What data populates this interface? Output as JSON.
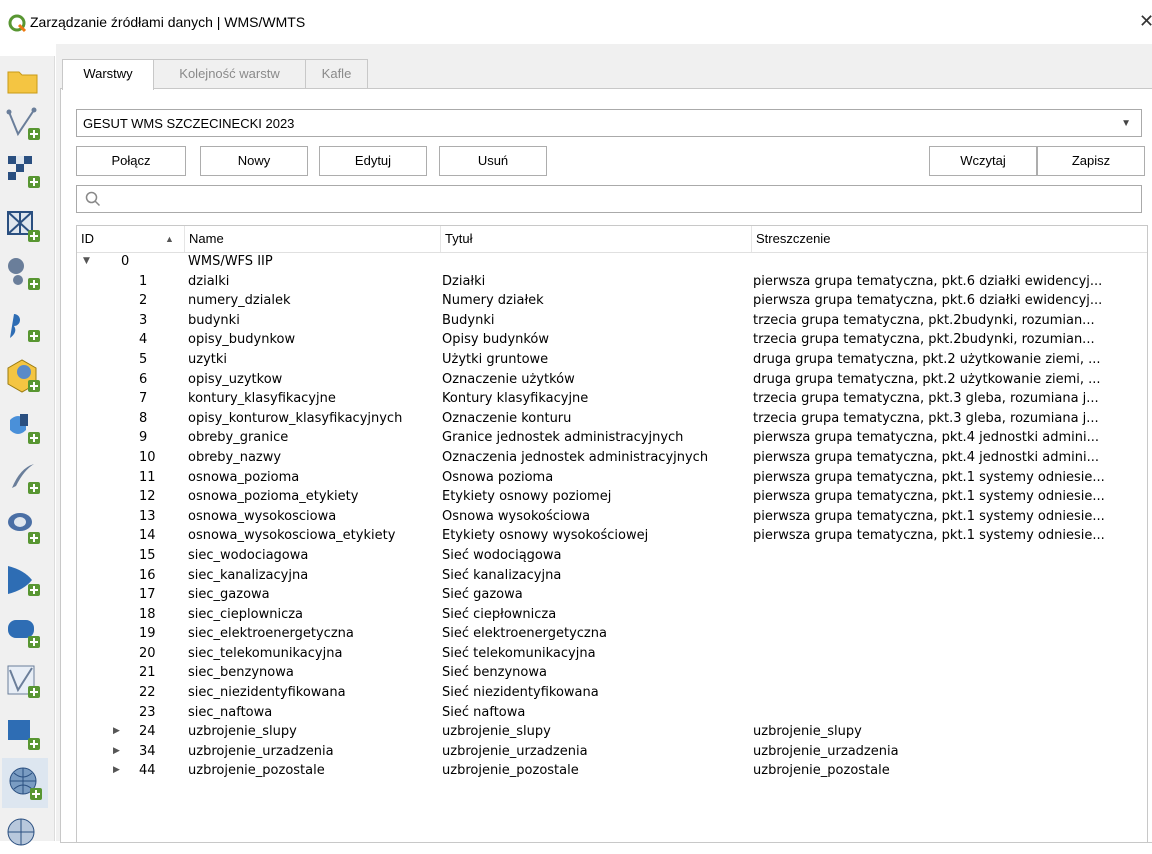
{
  "window": {
    "title": "Zarządzanie źródłami danych | WMS/WMTS",
    "close_glyph": "✕"
  },
  "sidebar": {
    "icons": [
      "open-folder-icon",
      "vector-layer-icon",
      "raster-layer-icon",
      "mesh-layer-icon",
      "point-cloud-icon",
      "delimited-text-icon",
      "geopackage-icon",
      "spatialite-icon",
      "postgis-icon",
      "mssql-icon",
      "oracle-icon",
      "db2-icon",
      "virtual-layer-icon",
      "sap-hana-icon",
      "wms-wmts-icon",
      "wfs-icon"
    ]
  },
  "tabs": [
    {
      "label": "Warstwy",
      "active": true
    },
    {
      "label": "Kolejność warstw",
      "active": false
    },
    {
      "label": "Kafle",
      "active": false
    }
  ],
  "connection": {
    "selected": "GESUT WMS SZCZECINECKI 2023"
  },
  "buttons": {
    "connect": "Połącz",
    "new": "Nowy",
    "edit": "Edytuj",
    "delete": "Usuń",
    "load": "Wczytaj",
    "save": "Zapisz"
  },
  "search": {
    "placeholder": ""
  },
  "table": {
    "headers": {
      "id": "ID",
      "name": "Name",
      "title": "Tytuł",
      "abstract": "Streszczenie"
    },
    "root": {
      "id": "0",
      "name": "WMS/WFS IIP",
      "title": "",
      "abstract": "",
      "expanded": true
    },
    "rows": [
      {
        "id": "1",
        "name": "dzialki",
        "title": "Działki",
        "abstract": "pierwsza grupa tematyczna, pkt.6 działki ewidencyj...",
        "expander": ""
      },
      {
        "id": "2",
        "name": "numery_dzialek",
        "title": "Numery działek",
        "abstract": "pierwsza grupa tematyczna, pkt.6 działki ewidencyj...",
        "expander": ""
      },
      {
        "id": "3",
        "name": "budynki",
        "title": "Budynki",
        "abstract": "trzecia grupa tematyczna, pkt.2budynki, rozumian...",
        "expander": ""
      },
      {
        "id": "4",
        "name": "opisy_budynkow",
        "title": "Opisy budynków",
        "abstract": "trzecia grupa tematyczna, pkt.2budynki, rozumian...",
        "expander": ""
      },
      {
        "id": "5",
        "name": "uzytki",
        "title": "Użytki gruntowe",
        "abstract": "druga grupa tematyczna, pkt.2 użytkowanie ziemi, ...",
        "expander": ""
      },
      {
        "id": "6",
        "name": "opisy_uzytkow",
        "title": "Oznaczenie użytków",
        "abstract": "druga grupa tematyczna, pkt.2 użytkowanie ziemi, ...",
        "expander": ""
      },
      {
        "id": "7",
        "name": "kontury_klasyfikacyjne",
        "title": "Kontury klasyfikacyjne",
        "abstract": "trzecia grupa tematyczna, pkt.3 gleba, rozumiana j...",
        "expander": ""
      },
      {
        "id": "8",
        "name": "opisy_konturow_klasyfikacyjnych",
        "title": "Oznaczenie konturu",
        "abstract": "trzecia grupa tematyczna, pkt.3 gleba, rozumiana j...",
        "expander": ""
      },
      {
        "id": "9",
        "name": "obreby_granice",
        "title": "Granice jednostek administracyjnych",
        "abstract": "pierwsza grupa tematyczna, pkt.4 jednostki admini...",
        "expander": ""
      },
      {
        "id": "10",
        "name": "obreby_nazwy",
        "title": "Oznaczenia jednostek administracyjnych",
        "abstract": "pierwsza grupa tematyczna, pkt.4 jednostki admini...",
        "expander": ""
      },
      {
        "id": "11",
        "name": "osnowa_pozioma",
        "title": "Osnowa pozioma",
        "abstract": "pierwsza grupa tematyczna, pkt.1 systemy odniesie...",
        "expander": ""
      },
      {
        "id": "12",
        "name": "osnowa_pozioma_etykiety",
        "title": "Etykiety osnowy poziomej",
        "abstract": "pierwsza grupa tematyczna, pkt.1 systemy odniesie...",
        "expander": ""
      },
      {
        "id": "13",
        "name": "osnowa_wysokosciowa",
        "title": "Osnowa wysokościowa",
        "abstract": "pierwsza grupa tematyczna, pkt.1 systemy odniesie...",
        "expander": ""
      },
      {
        "id": "14",
        "name": "osnowa_wysokosciowa_etykiety",
        "title": "Etykiety osnowy wysokościowej",
        "abstract": "pierwsza grupa tematyczna, pkt.1 systemy odniesie...",
        "expander": ""
      },
      {
        "id": "15",
        "name": "siec_wodociagowa",
        "title": "Sieć wodociągowa",
        "abstract": "",
        "expander": ""
      },
      {
        "id": "16",
        "name": "siec_kanalizacyjna",
        "title": "Sieć kanalizacyjna",
        "abstract": "",
        "expander": ""
      },
      {
        "id": "17",
        "name": "siec_gazowa",
        "title": "Sieć gazowa",
        "abstract": "",
        "expander": ""
      },
      {
        "id": "18",
        "name": "siec_cieplownicza",
        "title": "Sieć ciepłownicza",
        "abstract": "",
        "expander": ""
      },
      {
        "id": "19",
        "name": "siec_elektroenergetyczna",
        "title": "Sieć elektroenergetyczna",
        "abstract": "",
        "expander": ""
      },
      {
        "id": "20",
        "name": "siec_telekomunikacyjna",
        "title": "Sieć telekomunikacyjna",
        "abstract": "",
        "expander": ""
      },
      {
        "id": "21",
        "name": "siec_benzynowa",
        "title": "Sieć benzynowa",
        "abstract": "",
        "expander": ""
      },
      {
        "id": "22",
        "name": "siec_niezidentyfikowana",
        "title": "Sieć niezidentyfikowana",
        "abstract": "",
        "expander": ""
      },
      {
        "id": "23",
        "name": "siec_naftowa",
        "title": "Sieć naftowa",
        "abstract": "",
        "expander": ""
      },
      {
        "id": "24",
        "name": "uzbrojenie_slupy",
        "title": "uzbrojenie_slupy",
        "abstract": "uzbrojenie_slupy",
        "expander": "▶"
      },
      {
        "id": "34",
        "name": "uzbrojenie_urzadzenia",
        "title": "uzbrojenie_urzadzenia",
        "abstract": "uzbrojenie_urzadzenia",
        "expander": "▶"
      },
      {
        "id": "44",
        "name": "uzbrojenie_pozostale",
        "title": "uzbrojenie_pozostale",
        "abstract": "uzbrojenie_pozostale",
        "expander": "▶"
      }
    ]
  },
  "colors": {
    "qgis_green": "#589632",
    "accent_blue": "#2e6db4"
  }
}
